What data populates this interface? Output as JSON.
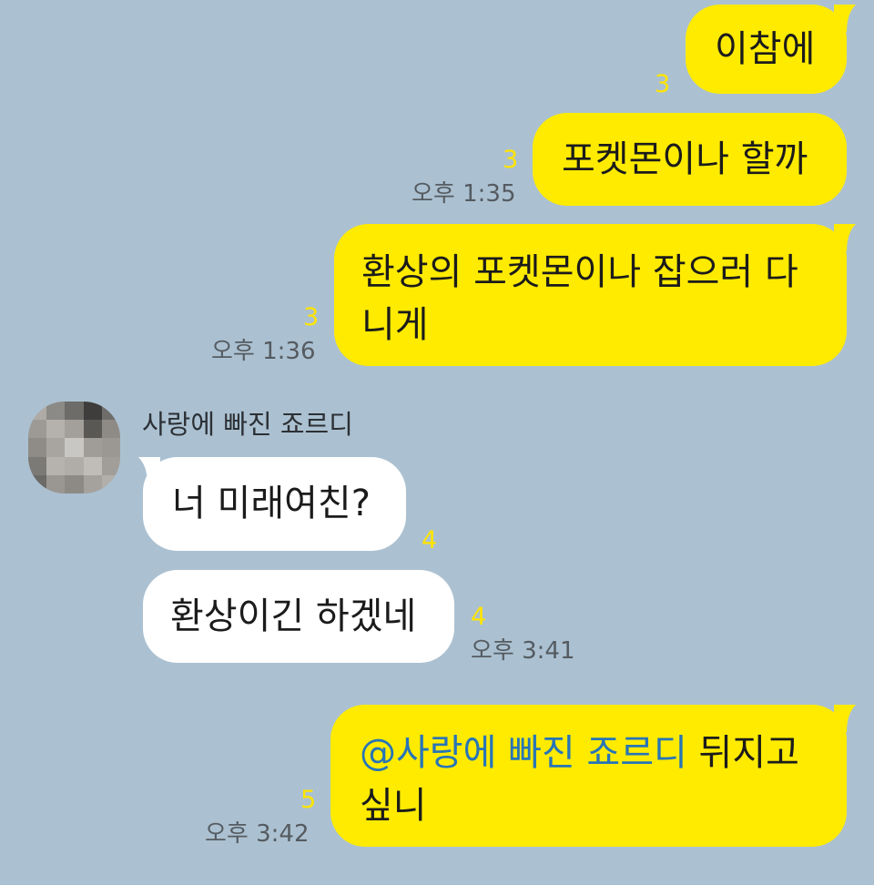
{
  "chat": {
    "messages": [
      {
        "sender": "me",
        "text": "이참에",
        "unread": "3"
      },
      {
        "sender": "me",
        "text": "포켓몬이나 할까",
        "unread": "3",
        "time": "오후 1:35"
      },
      {
        "sender": "me",
        "line1": "환상의 포켓몬이나 잡으러 다",
        "line2": "니게",
        "unread": "3",
        "time": "오후 1:36"
      },
      {
        "sender": "friend",
        "sender_name": "사랑에 빠진 죠르디",
        "text": "너 미래여친?",
        "unread": "4"
      },
      {
        "sender": "friend",
        "text": "환상이긴 하겠네",
        "unread": "4",
        "time": "오후 3:41"
      },
      {
        "sender": "me",
        "mention": "@사랑에 빠진 죠르디",
        "after_mention": " 뒤지고",
        "line2": "싶니",
        "unread": "5",
        "time": "오후 3:42"
      }
    ]
  },
  "colors": {
    "background": "#abc1d1",
    "my_bubble": "#ffeb00",
    "friend_bubble": "#ffffff",
    "unread_count": "#ffe400",
    "mention": "#2775b7"
  },
  "icons": {
    "avatar": "pixelated-profile-avatar-icon"
  }
}
